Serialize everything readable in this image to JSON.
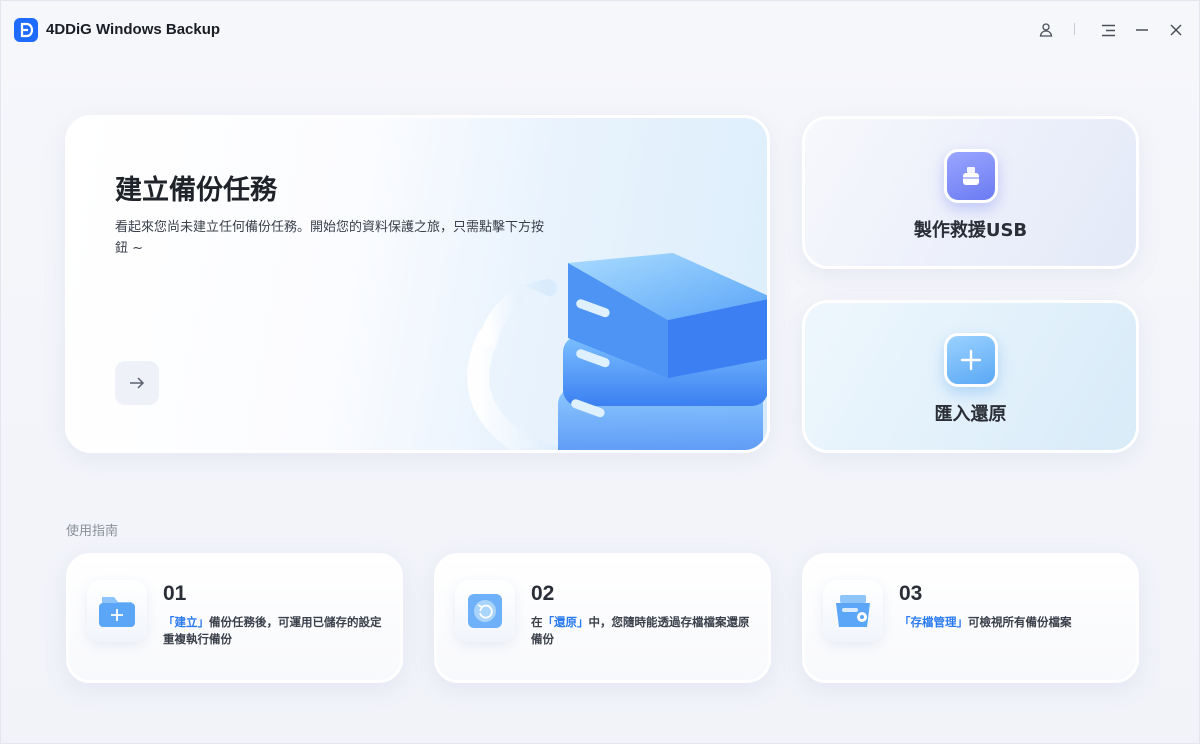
{
  "app": {
    "title": "4DDiG Windows Backup"
  },
  "titlebar": {
    "icons": [
      "user-icon",
      "menu-icon",
      "minimize-icon",
      "close-icon"
    ]
  },
  "hero": {
    "title": "建立備份任務",
    "description": "看起來您尚未建立任何備份任務。開始您的資料保護之旅，只需點擊下方按鈕 ~",
    "action_icon": "arrow-right-icon"
  },
  "side_cards": {
    "usb": {
      "label": "製作救援USB",
      "icon": "usb-icon"
    },
    "import": {
      "label": "匯入還原",
      "icon": "plus-icon"
    }
  },
  "guide": {
    "title": "使用指南",
    "items": [
      {
        "num": "01",
        "highlight": "「建立」",
        "text": "備份任務後，可運用已儲存的設定重複執行備份",
        "icon": "folder-add-icon"
      },
      {
        "num": "02",
        "prefix": "在",
        "highlight": "「還原」",
        "text": "中，您隨時能透過存檔檔案還原備份",
        "icon": "restore-disk-icon"
      },
      {
        "num": "03",
        "highlight": "「存檔管理」",
        "text": "可檢視所有備份檔案",
        "icon": "archive-manage-icon"
      }
    ]
  },
  "colors": {
    "accent": "#1f6bff",
    "highlight": "#2b7bf0"
  }
}
